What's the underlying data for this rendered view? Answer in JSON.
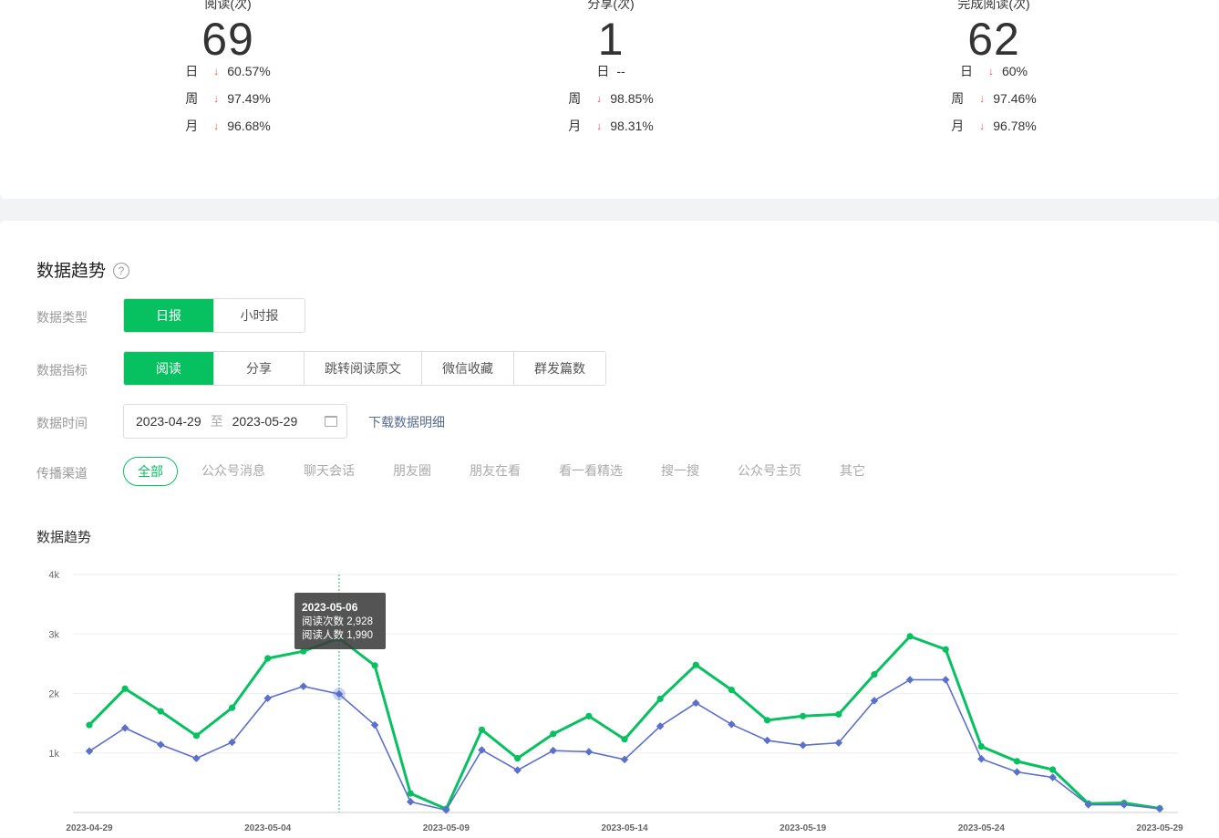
{
  "stats": [
    {
      "label": "阅读(次)",
      "value": "69",
      "rows": [
        {
          "period": "日",
          "arrow": "↓",
          "pct": "60.57%"
        },
        {
          "period": "周",
          "arrow": "↓",
          "pct": "97.49%"
        },
        {
          "period": "月",
          "arrow": "↓",
          "pct": "96.68%"
        }
      ]
    },
    {
      "label": "分享(次)",
      "value": "1",
      "rows": [
        {
          "period": "日",
          "arrow": "",
          "pct": "--"
        },
        {
          "period": "周",
          "arrow": "↓",
          "pct": "98.85%"
        },
        {
          "period": "月",
          "arrow": "↓",
          "pct": "98.31%"
        }
      ]
    },
    {
      "label": "完成阅读(次)",
      "value": "62",
      "rows": [
        {
          "period": "日",
          "arrow": "↓",
          "pct": "60%"
        },
        {
          "period": "周",
          "arrow": "↓",
          "pct": "97.46%"
        },
        {
          "period": "月",
          "arrow": "↓",
          "pct": "96.78%"
        }
      ]
    }
  ],
  "section": {
    "title": "数据趋势",
    "help": "?"
  },
  "filters": {
    "type_label": "数据类型",
    "type_options": [
      "日报",
      "小时报"
    ],
    "metric_label": "数据指标",
    "metric_options": [
      "阅读",
      "分享",
      "跳转阅读原文",
      "微信收藏",
      "群发篇数"
    ],
    "time_label": "数据时间",
    "date_start": "2023-04-29",
    "date_sep": "至",
    "date_end": "2023-05-29",
    "download": "下载数据明细",
    "channel_label": "传播渠道",
    "channels": [
      "全部",
      "公众号消息",
      "聊天会话",
      "朋友圈",
      "朋友在看",
      "看一看精选",
      "搜一搜",
      "公众号主页",
      "其它"
    ]
  },
  "chart_title": "数据趋势",
  "colors": {
    "accent": "#07c160",
    "series2": "#5b6fcd",
    "down": "#f04a4a"
  },
  "chart_data": {
    "type": "line",
    "x": [
      "2023-04-29",
      "2023-04-30",
      "2023-05-01",
      "2023-05-02",
      "2023-05-03",
      "2023-05-04",
      "2023-05-05",
      "2023-05-06",
      "2023-05-07",
      "2023-05-08",
      "2023-05-09",
      "2023-05-10",
      "2023-05-11",
      "2023-05-12",
      "2023-05-13",
      "2023-05-14",
      "2023-05-15",
      "2023-05-16",
      "2023-05-17",
      "2023-05-18",
      "2023-05-19",
      "2023-05-20",
      "2023-05-21",
      "2023-05-22",
      "2023-05-23",
      "2023-05-24",
      "2023-05-25",
      "2023-05-26",
      "2023-05-27",
      "2023-05-28",
      "2023-05-29"
    ],
    "x_tick_labels": [
      "2023-04-29",
      "2023-05-04",
      "2023-05-09",
      "2023-05-14",
      "2023-05-19",
      "2023-05-24",
      "2023-05-29"
    ],
    "y_tick_labels": [
      "1k",
      "2k",
      "3k",
      "4k"
    ],
    "ylim": [
      0,
      4000
    ],
    "series": [
      {
        "name": "阅读次数",
        "color": "#07c160",
        "values": [
          1470,
          2080,
          1700,
          1290,
          1760,
          2590,
          2710,
          2928,
          2470,
          320,
          60,
          1390,
          910,
          1320,
          1620,
          1230,
          1910,
          2480,
          2060,
          1550,
          1620,
          1650,
          2320,
          2960,
          2740,
          1110,
          860,
          720,
          150,
          160,
          69
        ]
      },
      {
        "name": "阅读人数",
        "color": "#5b6fcd",
        "values": [
          1030,
          1420,
          1140,
          910,
          1180,
          1920,
          2120,
          1990,
          1470,
          180,
          40,
          1050,
          710,
          1040,
          1020,
          890,
          1450,
          1840,
          1480,
          1210,
          1130,
          1170,
          1880,
          2230,
          2230,
          900,
          680,
          590,
          130,
          130,
          62
        ]
      }
    ],
    "tooltip": {
      "date": "2023-05-06",
      "lines": [
        "阅读次数 2,928",
        "阅读人数 1,990"
      ]
    }
  }
}
